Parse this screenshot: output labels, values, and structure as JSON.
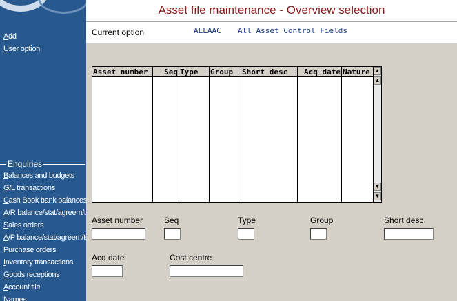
{
  "window": {
    "title": "Asset file maintenance - Overview selection"
  },
  "sidebar": {
    "top_items": [
      {
        "label": "Add",
        "accel": "A"
      },
      {
        "label": "User option",
        "accel": "U"
      }
    ],
    "enquiries_title": "Enquiries",
    "enquiries": [
      {
        "label": "Balances and budgets"
      },
      {
        "label": "G/L transactions"
      },
      {
        "label": "Cash Book bank balances"
      },
      {
        "label": "A/R balance/stat/agreem/trar"
      },
      {
        "label": "Sales orders"
      },
      {
        "label": "A/P balance/stat/agreem/trar"
      },
      {
        "label": "Purchase orders"
      },
      {
        "label": "Inventory transactions"
      },
      {
        "label": "Goods receptions"
      },
      {
        "label": "Account file"
      },
      {
        "label": "Names"
      }
    ]
  },
  "current_option": {
    "label": "Current option",
    "code": "ALLAAC",
    "description": "All Asset Control Fields"
  },
  "grid": {
    "columns": [
      "Asset number",
      "Seq",
      "Type",
      "Group",
      "Short desc",
      "Acq date",
      "Nature"
    ],
    "rows": [],
    "scroll_up_glyph": "▲",
    "scroll_down_glyph": "▼"
  },
  "selection": {
    "asset_number": {
      "label": "Asset number",
      "value": ""
    },
    "seq": {
      "label": "Seq",
      "value": ""
    },
    "type": {
      "label": "Type",
      "value": ""
    },
    "group": {
      "label": "Group",
      "value": ""
    },
    "short_desc": {
      "label": "Short desc",
      "value": ""
    },
    "acq_date": {
      "label": "Acq date",
      "value": ""
    },
    "cost_centre": {
      "label": "Cost centre",
      "value": ""
    }
  },
  "colors": {
    "sidebar_bg": "#27598e",
    "title_text": "#8b1a1a",
    "option_text": "#1a3d8f",
    "form_bg": "#d4d0c8"
  }
}
